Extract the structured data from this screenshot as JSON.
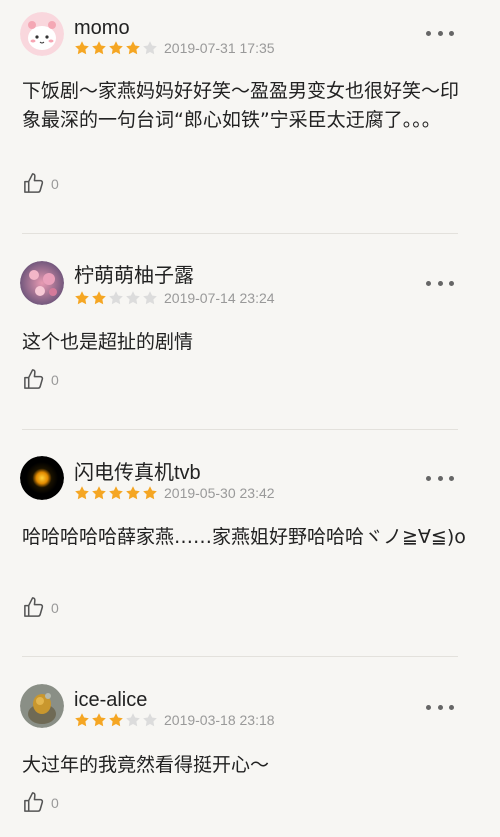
{
  "reviews": [
    {
      "username": "momo",
      "rating": 4,
      "rating_max": 5,
      "timestamp": "2019-07-31 17:35",
      "avatar": "pink-cartoon-avatar",
      "content": "下饭剧～家燕妈妈好好笑～盈盈男变女也很好笑～印象最深的一句台词“郎心如铁”宁采臣太迂腐了。。。",
      "likes": "0"
    },
    {
      "username": "柠萌萌柚子露",
      "rating": 2,
      "rating_max": 5,
      "timestamp": "2019-07-14 23:24",
      "avatar": "cherry-blossom-avatar",
      "content": "这个也是超扯的剧情",
      "likes": "0"
    },
    {
      "username": "闪电传真机tvb",
      "rating": 5,
      "rating_max": 5,
      "timestamp": "2019-05-30 23:42",
      "avatar": "glowing-dot-avatar",
      "content": "哈哈哈哈哈薛家燕……家燕姐好野哈哈哈ヾノ≧∀≦)o",
      "likes": "0"
    },
    {
      "username": "ice-alice",
      "rating": 3,
      "rating_max": 5,
      "timestamp": "2019-03-18 23:18",
      "avatar": "photo-avatar",
      "content": "大过年的我竟然看得挺开心～",
      "likes": "0"
    }
  ],
  "colors": {
    "star_filled": "#f5a623",
    "star_empty": "#dcdcdc",
    "background": "#f7f6f3",
    "meta_text": "#999999"
  },
  "icons": {
    "more": "more-dots-icon",
    "like": "thumbs-up-icon",
    "star": "star-icon"
  }
}
